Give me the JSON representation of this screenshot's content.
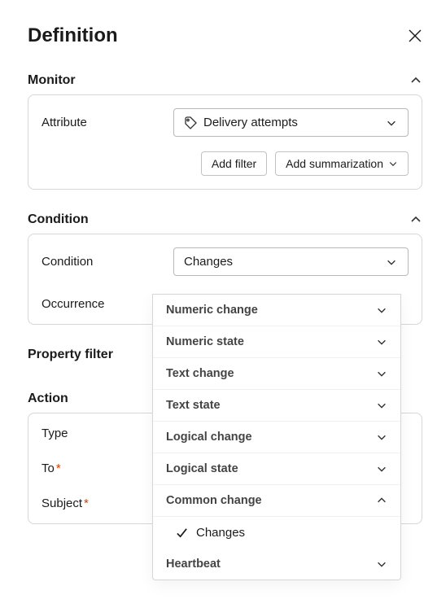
{
  "header": {
    "title": "Definition"
  },
  "sections": {
    "monitor": {
      "title": "Monitor",
      "attribute_label": "Attribute",
      "attribute_value": "Delivery attempts",
      "add_filter_label": "Add filter",
      "add_summarization_label": "Add summarization"
    },
    "condition": {
      "title": "Condition",
      "condition_label": "Condition",
      "condition_value": "Changes",
      "occurrence_label": "Occurrence"
    },
    "property_filter": {
      "title": "Property filter"
    },
    "action": {
      "title": "Action",
      "type_label": "Type",
      "to_label": "To",
      "subject_label": "Subject"
    }
  },
  "dropdown": {
    "items": [
      {
        "label": "Numeric change",
        "expanded": false,
        "type": "group"
      },
      {
        "label": "Numeric state",
        "expanded": false,
        "type": "group"
      },
      {
        "label": "Text change",
        "expanded": false,
        "type": "group"
      },
      {
        "label": "Text state",
        "expanded": false,
        "type": "group"
      },
      {
        "label": "Logical change",
        "expanded": false,
        "type": "group"
      },
      {
        "label": "Logical state",
        "expanded": false,
        "type": "group"
      },
      {
        "label": "Common change",
        "expanded": true,
        "type": "group"
      },
      {
        "label": "Changes",
        "selected": true,
        "type": "option"
      },
      {
        "label": "Heartbeat",
        "expanded": false,
        "type": "group"
      }
    ]
  }
}
